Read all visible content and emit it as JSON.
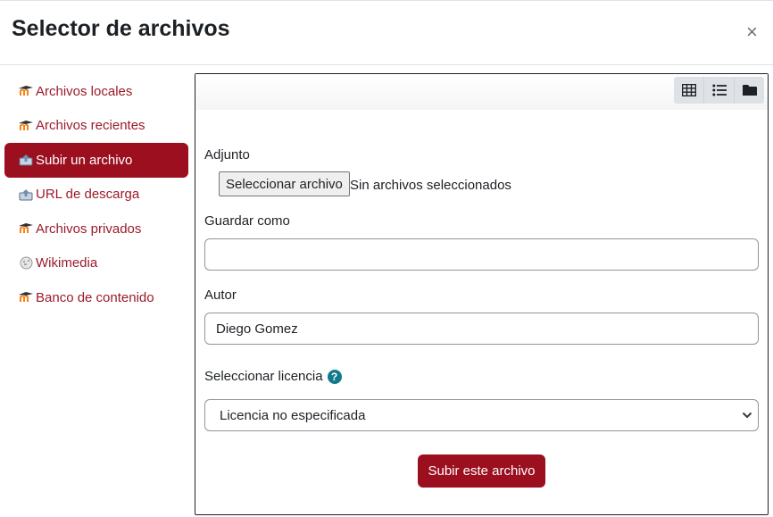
{
  "dialog": {
    "title": "Selector de archivos",
    "close_label": "×"
  },
  "sidebar": {
    "items": [
      {
        "label": "Archivos locales",
        "icon": "moodle-icon"
      },
      {
        "label": "Archivos recientes",
        "icon": "moodle-icon"
      },
      {
        "label": "Subir un archivo",
        "icon": "upload-icon",
        "active": true
      },
      {
        "label": "URL de descarga",
        "icon": "url-download-icon"
      },
      {
        "label": "Archivos privados",
        "icon": "moodle-icon"
      },
      {
        "label": "Wikimedia",
        "icon": "wikimedia-icon"
      },
      {
        "label": "Banco de contenido",
        "icon": "moodle-icon"
      }
    ]
  },
  "toolbar": {
    "views": [
      "grid-view-icon",
      "list-view-icon",
      "folder-view-icon"
    ]
  },
  "form": {
    "attachment_label": "Adjunto",
    "choose_file_button": "Seleccionar archivo",
    "no_file_text": "Sin archivos seleccionados",
    "save_as_label": "Guardar como",
    "save_as_value": "",
    "author_label": "Autor",
    "author_value": "Diego Gomez",
    "license_label": "Seleccionar licencia",
    "license_value": "Licencia no especificada",
    "submit_label": "Subir este archivo"
  },
  "colors": {
    "accent": "#9b0f1f",
    "link": "#9b1b2a",
    "help": "#117a8b"
  }
}
